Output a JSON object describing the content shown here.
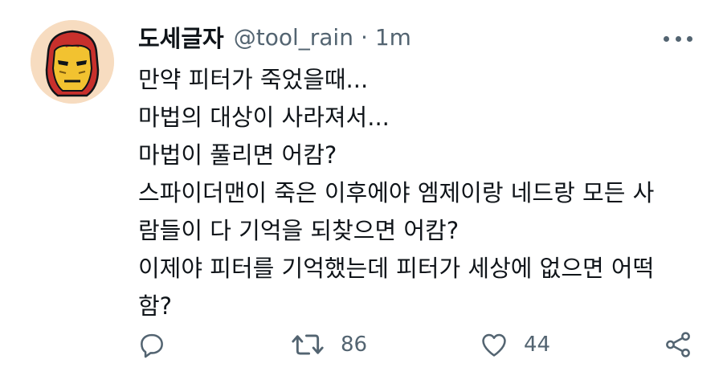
{
  "tweet": {
    "display_name": "도세글자",
    "handle": "@tool_rain",
    "separator": "·",
    "time": "1m",
    "lines": [
      "만약 피터가 죽었을때...",
      "마법의 대상이 사라져서...",
      "마법이 풀리면 어캄?",
      "스파이더맨이 죽은 이후에야 엠제이랑 네드랑 모든 사",
      "람들이 다 기억을 되찾으면 어캄?",
      "이제야 피터를 기억했는데 피터가 세상에 없으면 어떡",
      "함?"
    ],
    "avatar_icon": "iron-man-helmet",
    "actions": {
      "reply_icon": "reply-icon",
      "retweet_icon": "retweet-icon",
      "retweet_count": "86",
      "like_icon": "heart-icon",
      "like_count": "44",
      "share_icon": "share-icon"
    }
  },
  "colors": {
    "text": "#0f1419",
    "secondary": "#536471",
    "avatar_bg": "#f7dcc0",
    "helmet_red": "#c8302c",
    "helmet_gold": "#f2c230"
  }
}
